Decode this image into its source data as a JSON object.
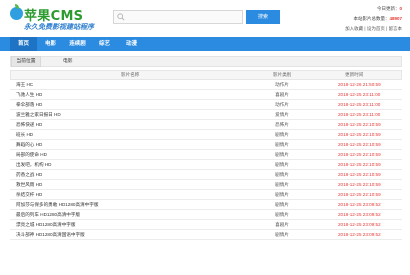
{
  "logo": {
    "name": "苹果CMS",
    "slogan": "永久免费影视建站程序"
  },
  "search": {
    "placeholder": "",
    "button_label": "搜索"
  },
  "userbox": {
    "today_label": "今日更新：",
    "today_value": "0",
    "total_label": "本站影片总数量：",
    "total_value": "48907",
    "links": "加入收藏 | 设为首页 | 留言本"
  },
  "nav": {
    "items": [
      "首页",
      "电影",
      "连续剧",
      "综艺",
      "动漫"
    ],
    "active_index": 0
  },
  "breadcrumb": {
    "home": "当前位置",
    "current": "电影"
  },
  "table": {
    "headers": {
      "name": "影片名称",
      "type": "影片类别",
      "time": "更新时间"
    },
    "rows": [
      {
        "name": "海王 HC",
        "type": "动作片",
        "time": "2018-12-26 21:50:59"
      },
      {
        "name": "飞驰人生 HD",
        "type": "喜剧片",
        "time": "2018-12-25 23:11:00"
      },
      {
        "name": "拳伞部落 HD",
        "type": "动作片",
        "time": "2018-12-25 23:11:00"
      },
      {
        "name": "波兰雅之家日报日 HD",
        "type": "爱情片",
        "time": "2018-12-25 23:11:00"
      },
      {
        "name": "恐怖快递 HD",
        "type": "恐怖片",
        "time": "2018-12-25 22:10:59"
      },
      {
        "name": "班长 HD",
        "type": "剧情片",
        "time": "2018-12-25 22:10:59"
      },
      {
        "name": "舞蹈的心 HD",
        "type": "剧情片",
        "time": "2018-12-25 22:10:59"
      },
      {
        "name": "局部的使命 HD",
        "type": "剧情片",
        "time": "2018-12-25 22:10:59"
      },
      {
        "name": "出发吧，机构 HD",
        "type": "剧情片",
        "time": "2018-12-25 22:10:59"
      },
      {
        "name": "药香之战 HD",
        "type": "剧情片",
        "time": "2018-12-25 22:10:59"
      },
      {
        "name": "救世风雨 HD",
        "type": "剧情片",
        "time": "2018-12-25 22:10:59"
      },
      {
        "name": "杀结交杆 HD",
        "type": "剧情片",
        "time": "2018-12-25 22:10:59"
      },
      {
        "name": "阿加莎与保多的勇敢 HD1280高清中字版",
        "type": "剧情片",
        "time": "2018-12-25 23:09:52"
      },
      {
        "name": "最后的列车 HD1280高清中字版",
        "type": "剧情片",
        "time": "2018-12-25 23:09:52"
      },
      {
        "name": "漂亮之城 HD1280高清中字版",
        "type": "喜剧片",
        "time": "2018-12-25 23:09:52"
      },
      {
        "name": "决斗部神 HD1280高清国语中字版",
        "type": "剧情片",
        "time": "2018-12-25 23:09:52"
      }
    ]
  },
  "colors": {
    "brand_blue": "#2a8be0",
    "logo_green": "#2b9a2f",
    "time_red": "#e43a35"
  }
}
